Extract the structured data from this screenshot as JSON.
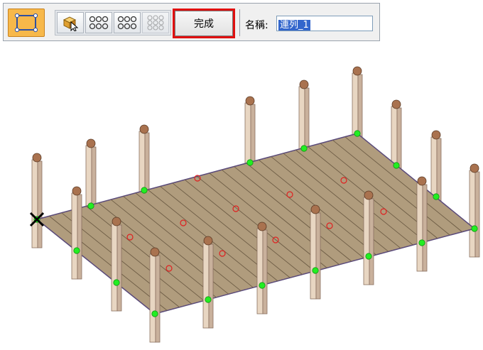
{
  "toolbar": {
    "select_tool_icon": "rectangle-select-icon",
    "place_icon": "cube-cursor-icon",
    "pattern_icons": [
      "circle-grid-2x3-icon",
      "circle-grid-2x3-alt-icon",
      "circle-grid-3x3-disabled-icon"
    ],
    "finish_label": "完成",
    "name_label": "名稱:",
    "name_value": "連列_1",
    "highlight_color": "#e01010",
    "accent_color": "#f7b84a"
  },
  "viewport": {
    "deck_color": "#b09c7d",
    "post_color": "#e8d6c2",
    "cap_color": "#a9724f",
    "point_color": "#22ee22",
    "marker_color": "#e02020"
  }
}
